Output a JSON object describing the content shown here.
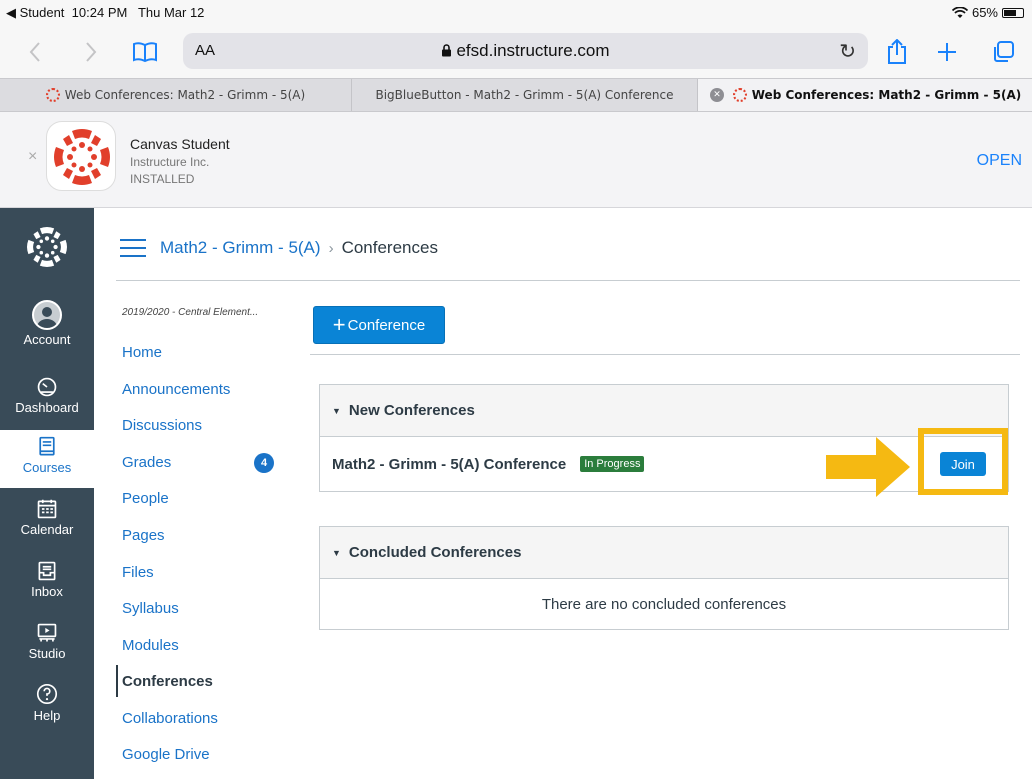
{
  "status_bar": {
    "back_app": "◀ Student",
    "time": "10:24 PM",
    "date": "Thu Mar 12",
    "battery": "65%"
  },
  "browser": {
    "text_size_label": "AA",
    "url": "efsd.instructure.com",
    "tabs": [
      {
        "title": "Web Conferences: Math2 - Grimm - 5(A)"
      },
      {
        "title": "BigBlueButton - Math2 - Grimm - 5(A) Conference"
      },
      {
        "title": "Web Conferences: Math2 - Grimm - 5(A)"
      }
    ]
  },
  "app_banner": {
    "name": "Canvas Student",
    "developer": "Instructure Inc.",
    "status": "INSTALLED",
    "open_label": "OPEN"
  },
  "global_nav": {
    "items": [
      {
        "label": "Account",
        "icon": "avatar"
      },
      {
        "label": "Dashboard",
        "icon": "dashboard-icon"
      },
      {
        "label": "Courses",
        "icon": "courses-icon"
      },
      {
        "label": "Calendar",
        "icon": "calendar-icon"
      },
      {
        "label": "Inbox",
        "icon": "inbox-icon"
      },
      {
        "label": "Studio",
        "icon": "studio-icon"
      },
      {
        "label": "Help",
        "icon": "help-icon"
      }
    ]
  },
  "breadcrumb": {
    "course": "Math2 - Grimm - 5(A)",
    "separator": "›",
    "current": "Conferences"
  },
  "course_nav": {
    "term": "2019/2020 - Central Element...",
    "items": [
      {
        "label": "Home"
      },
      {
        "label": "Announcements"
      },
      {
        "label": "Discussions"
      },
      {
        "label": "Grades",
        "badge": "4"
      },
      {
        "label": "People"
      },
      {
        "label": "Pages"
      },
      {
        "label": "Files"
      },
      {
        "label": "Syllabus"
      },
      {
        "label": "Modules"
      },
      {
        "label": "Conferences"
      },
      {
        "label": "Collaborations"
      },
      {
        "label": "Google Drive"
      }
    ]
  },
  "main": {
    "add_button_label": "Conference",
    "new_section": {
      "title": "New Conferences",
      "conference_name": "Math2 - Grimm - 5(A) Conference",
      "status": "In Progress",
      "join_label": "Join"
    },
    "concluded_section": {
      "title": "Concluded Conferences",
      "empty_message": "There are no concluded conferences"
    }
  },
  "colors": {
    "canvas_red": "#e13f2b",
    "link_blue": "#1a73c8",
    "nav_bg": "#394b58",
    "highlight": "#f5b912",
    "success": "#2b7d3c"
  }
}
